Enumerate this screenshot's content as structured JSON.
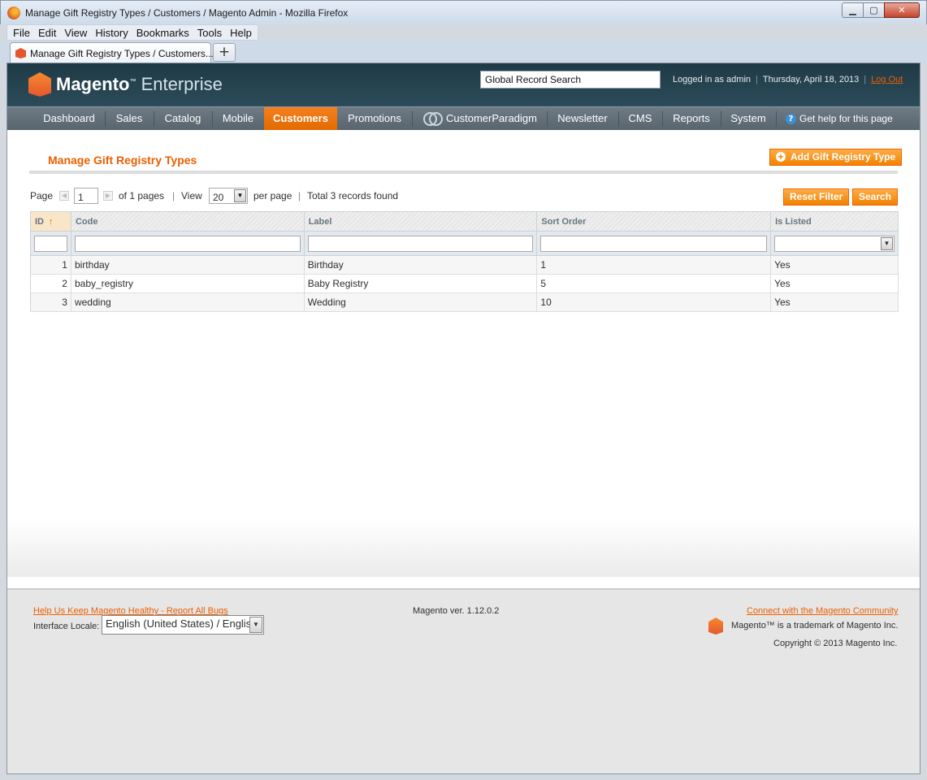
{
  "window": {
    "title": "Manage Gift Registry Types / Customers / Magento Admin - Mozilla Firefox",
    "minimize": "▁",
    "maximize": "▢",
    "close": "✕"
  },
  "menubar": [
    "File",
    "Edit",
    "View",
    "History",
    "Bookmarks",
    "Tools",
    "Help"
  ],
  "tab": {
    "label": "Manage Gift Registry Types / Customers...",
    "new_tab": "+"
  },
  "header": {
    "logo_brand": "Magento",
    "logo_suffix": "Enterprise",
    "search_value": "Global Record Search",
    "logged_in": "Logged in as admin",
    "date": "Thursday, April 18, 2013",
    "logout": "Log Out"
  },
  "nav": {
    "items": [
      "Dashboard",
      "Sales",
      "Catalog",
      "Mobile",
      "Customers",
      "Promotions",
      "CustomerParadigm",
      "Newsletter",
      "CMS",
      "Reports",
      "System"
    ],
    "active": "Customers",
    "help": "Get help for this page"
  },
  "page": {
    "title": "Manage Gift Registry Types",
    "add_button": "Add Gift Registry Type",
    "reset_button": "Reset Filter",
    "search_button": "Search"
  },
  "pager": {
    "page_label": "Page",
    "page_value": "1",
    "of_pages": "of 1 pages",
    "view_label": "View",
    "view_value": "20",
    "per_page": "per page",
    "total": "Total 3 records found"
  },
  "grid": {
    "columns": [
      "ID",
      "Code",
      "Label",
      "Sort Order",
      "Is Listed"
    ],
    "rows": [
      {
        "id": "1",
        "code": "birthday",
        "label": "Birthday",
        "sort": "1",
        "listed": "Yes"
      },
      {
        "id": "2",
        "code": "baby_registry",
        "label": "Baby Registry",
        "sort": "5",
        "listed": "Yes"
      },
      {
        "id": "3",
        "code": "wedding",
        "label": "Wedding",
        "sort": "10",
        "listed": "Yes"
      }
    ]
  },
  "footer": {
    "bug_link": "Help Us Keep Magento Healthy - Report All Bugs",
    "version": "Magento ver. 1.12.0.2",
    "community_link": "Connect with the Magento Community",
    "locale_label": "Interface Locale:",
    "locale_value": "English (United States) / English",
    "trademark": "Magento™ is a trademark of Magento Inc.",
    "copyright": "Copyright © 2013 Magento Inc."
  }
}
